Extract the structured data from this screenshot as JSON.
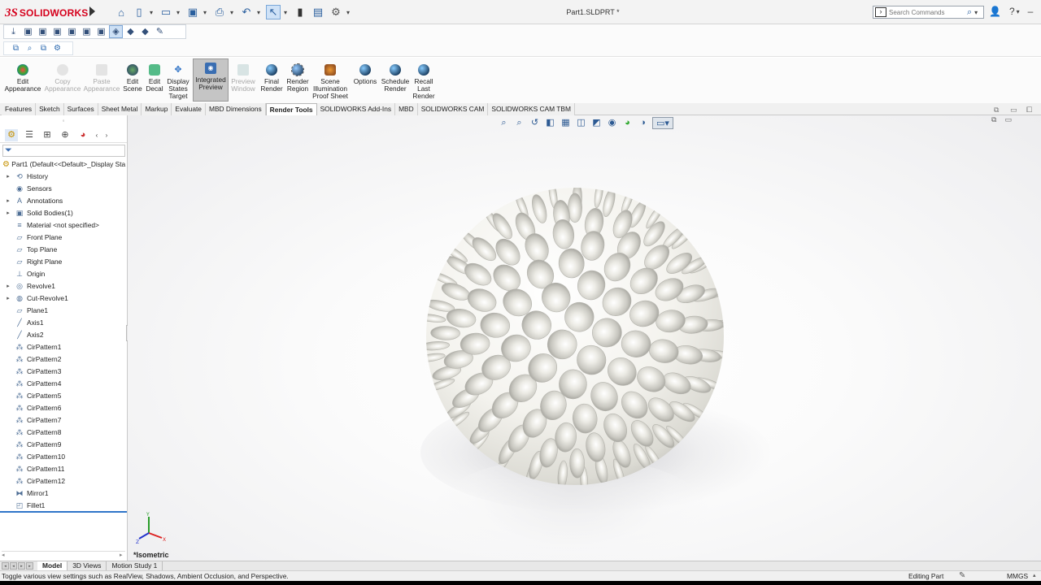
{
  "app": {
    "brand_prefix": "3S",
    "brand_name": "SOLIDWORKS",
    "document_title": "Part1.SLDPRT *"
  },
  "search": {
    "placeholder": "Search Commands"
  },
  "ribbon": {
    "buttons": [
      {
        "label": "Edit\nAppearance",
        "icon": "appearance-icon",
        "state": "normal"
      },
      {
        "label": "Copy\nAppearance",
        "icon": "copy-appearance-icon",
        "state": "disabled"
      },
      {
        "label": "Paste\nAppearance",
        "icon": "paste-appearance-icon",
        "state": "disabled"
      },
      {
        "label": "Edit\nScene",
        "icon": "scene-icon",
        "state": "normal"
      },
      {
        "label": "Edit\nDecal",
        "icon": "decal-icon",
        "state": "normal"
      },
      {
        "label": "Display\nStates\nTarget",
        "icon": "display-states-icon",
        "state": "normal"
      },
      {
        "label": "Integrated\nPreview",
        "icon": "integrated-preview-icon",
        "state": "active"
      },
      {
        "label": "Preview\nWindow",
        "icon": "preview-window-icon",
        "state": "disabled"
      },
      {
        "label": "Final\nRender",
        "icon": "final-render-icon",
        "state": "normal"
      },
      {
        "label": "Render\nRegion",
        "icon": "render-region-icon",
        "state": "normal"
      },
      {
        "label": "Scene\nIllumination\nProof Sheet",
        "icon": "illumination-icon",
        "state": "normal"
      },
      {
        "label": "Options",
        "icon": "options-icon",
        "state": "normal"
      },
      {
        "label": "Schedule\nRender",
        "icon": "schedule-icon",
        "state": "normal"
      },
      {
        "label": "Recall\nLast\nRender",
        "icon": "recall-icon",
        "state": "normal"
      }
    ]
  },
  "tabs": [
    {
      "label": "Features",
      "active": false
    },
    {
      "label": "Sketch",
      "active": false
    },
    {
      "label": "Surfaces",
      "active": false
    },
    {
      "label": "Sheet Metal",
      "active": false
    },
    {
      "label": "Markup",
      "active": false
    },
    {
      "label": "Evaluate",
      "active": false
    },
    {
      "label": "MBD Dimensions",
      "active": false
    },
    {
      "label": "Render Tools",
      "active": true
    },
    {
      "label": "SOLIDWORKS Add-Ins",
      "active": false
    },
    {
      "label": "MBD",
      "active": false
    },
    {
      "label": "SOLIDWORKS CAM",
      "active": false
    },
    {
      "label": "SOLIDWORKS CAM TBM",
      "active": false
    }
  ],
  "tree": {
    "root": "Part1  (Default<<Default>_Display Sta",
    "items": [
      {
        "label": "History",
        "expandable": true,
        "icon": "history-icon"
      },
      {
        "label": "Sensors",
        "expandable": false,
        "icon": "sensor-icon"
      },
      {
        "label": "Annotations",
        "expandable": true,
        "icon": "annotations-icon"
      },
      {
        "label": "Solid Bodies(1)",
        "expandable": true,
        "icon": "solid-bodies-icon"
      },
      {
        "label": "Material <not specified>",
        "expandable": false,
        "icon": "material-icon"
      },
      {
        "label": "Front Plane",
        "expandable": false,
        "icon": "plane-icon"
      },
      {
        "label": "Top Plane",
        "expandable": false,
        "icon": "plane-icon"
      },
      {
        "label": "Right Plane",
        "expandable": false,
        "icon": "plane-icon"
      },
      {
        "label": "Origin",
        "expandable": false,
        "icon": "origin-icon"
      },
      {
        "label": "Revolve1",
        "expandable": true,
        "icon": "revolve-icon"
      },
      {
        "label": "Cut-Revolve1",
        "expandable": true,
        "icon": "cut-revolve-icon"
      },
      {
        "label": "Plane1",
        "expandable": false,
        "icon": "plane-icon"
      },
      {
        "label": "Axis1",
        "expandable": false,
        "icon": "axis-icon"
      },
      {
        "label": "Axis2",
        "expandable": false,
        "icon": "axis-icon"
      },
      {
        "label": "CirPattern1",
        "expandable": false,
        "icon": "circular-pattern-icon"
      },
      {
        "label": "CirPattern2",
        "expandable": false,
        "icon": "circular-pattern-icon"
      },
      {
        "label": "CirPattern3",
        "expandable": false,
        "icon": "circular-pattern-icon"
      },
      {
        "label": "CirPattern4",
        "expandable": false,
        "icon": "circular-pattern-icon"
      },
      {
        "label": "CirPattern5",
        "expandable": false,
        "icon": "circular-pattern-icon"
      },
      {
        "label": "CirPattern6",
        "expandable": false,
        "icon": "circular-pattern-icon"
      },
      {
        "label": "CirPattern7",
        "expandable": false,
        "icon": "circular-pattern-icon"
      },
      {
        "label": "CirPattern8",
        "expandable": false,
        "icon": "circular-pattern-icon"
      },
      {
        "label": "CirPattern9",
        "expandable": false,
        "icon": "circular-pattern-icon"
      },
      {
        "label": "CirPattern10",
        "expandable": false,
        "icon": "circular-pattern-icon"
      },
      {
        "label": "CirPattern11",
        "expandable": false,
        "icon": "circular-pattern-icon"
      },
      {
        "label": "CirPattern12",
        "expandable": false,
        "icon": "circular-pattern-icon"
      },
      {
        "label": "Mirror1",
        "expandable": false,
        "icon": "mirror-icon"
      },
      {
        "label": "Fillet1",
        "expandable": false,
        "icon": "fillet-icon"
      }
    ]
  },
  "viewport": {
    "view_label": "*Isometric",
    "model": "golf-ball"
  },
  "bottom_tabs": [
    {
      "label": "Model",
      "active": true
    },
    {
      "label": "3D Views",
      "active": false
    },
    {
      "label": "Motion Study 1",
      "active": false
    }
  ],
  "status": {
    "message": "Toggle various view settings such as RealView, Shadows, Ambient Occlusion, and Perspective.",
    "mode": "Editing Part",
    "units": "MMGS"
  },
  "colors": {
    "brand": "#d6001c",
    "accent": "#2f75c9"
  }
}
